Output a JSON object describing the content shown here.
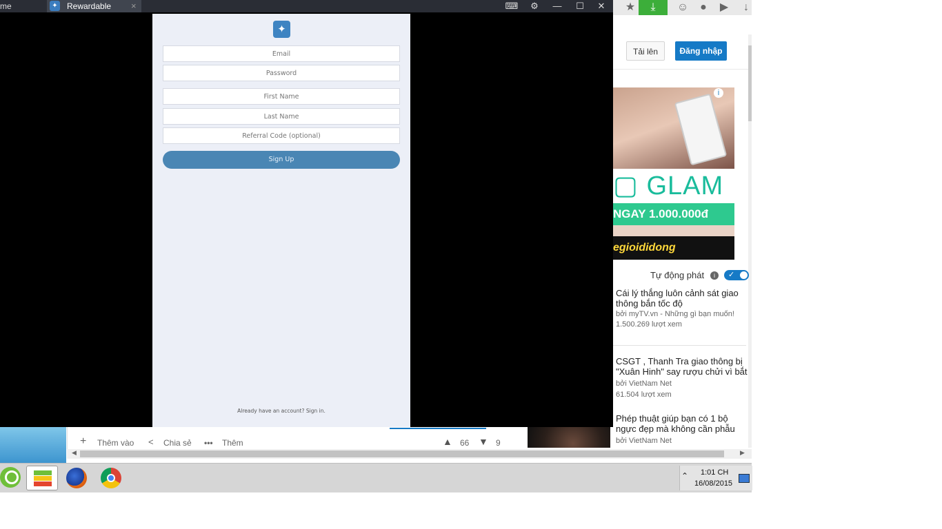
{
  "browser": {
    "prev_tab_fragment": "me",
    "youtube": {
      "upload_label": "Tải lên",
      "login_label": "Đăng nhập",
      "ad": {
        "glam_text": "GLAM",
        "promo_text": "NGAY 1.000.000đ",
        "brand_text": "egioididong",
        "info_glyph": "i"
      },
      "autoplay_label": "Tự động phát",
      "recommended": [
        {
          "title": "Cái lý thắng luôn cảnh sát giao thông bắn tốc độ",
          "channel": "bởi myTV.vn - Những gì bạn muốn!",
          "views": "1.500.269 lượt xem"
        },
        {
          "title": "CSGT , Thanh Tra giao thông bị \"Xuân Hinh\" say rượu chửi vì bắt",
          "channel": "bởi VietNam Net",
          "views": "61.504 lượt xem"
        },
        {
          "title": "Phép thuật giúp bạn có 1 bộ ngực đẹp mà không cần phẫu",
          "channel": "bởi VietNam Net"
        }
      ],
      "actions": {
        "add_label": "Thêm vào",
        "share_label": "Chia sẻ",
        "more_label": "Thêm",
        "likes": "66",
        "dislikes": "9"
      }
    }
  },
  "bluestacks": {
    "tab_title": "Rewardable"
  },
  "app": {
    "email_placeholder": "Email",
    "password_placeholder": "Password",
    "first_name_placeholder": "First Name",
    "last_name_placeholder": "Last Name",
    "referral_placeholder": "Referral Code (optional)",
    "signup_label": "Sign Up",
    "signin_text": "Already have an account? Sign in."
  },
  "taskbar": {
    "time": "1:01 CH",
    "date": "16/08/2015"
  },
  "colors": {
    "signup_button": "#4a86b4",
    "app_background": "#eceff7",
    "youtube_blue": "#167ac6",
    "window_chrome": "#2a2d35"
  }
}
